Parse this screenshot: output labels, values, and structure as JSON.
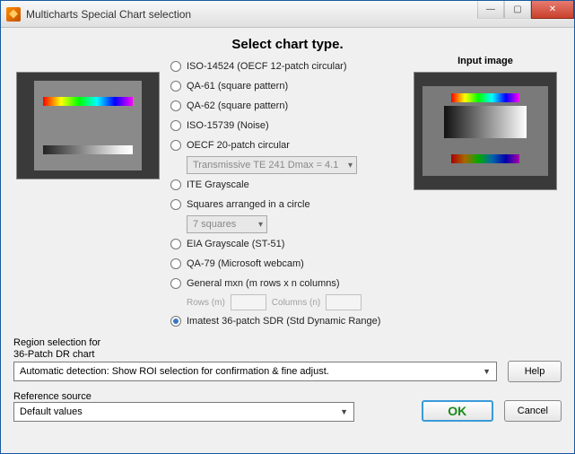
{
  "window": {
    "title": "Multicharts Special Chart selection"
  },
  "heading": "Select chart type.",
  "input_image_label": "Input image",
  "options": {
    "iso14524": "ISO-14524 (OECF 12-patch circular)",
    "qa61": "QA-61 (square pattern)",
    "qa62": "QA-62 (square pattern)",
    "iso15739": "ISO-15739 (Noise)",
    "oecf20": "OECF 20-patch circular",
    "oecf20_select": "Transmissive TE 241 Dmax = 4.1",
    "ite": "ITE Grayscale",
    "squares": "Squares arranged in a circle",
    "squares_select": "7  squares",
    "eia": "EIA Grayscale (ST-51)",
    "qa79": "QA-79 (Microsoft webcam)",
    "general": "General mxn (m rows x n columns)",
    "rows_label": "Rows (m)",
    "cols_label": "Columns (n)",
    "imatest36": "Imatest 36-patch SDR (Std Dynamic Range)"
  },
  "selected_option": "imatest36",
  "region_selection_label": "Region selection for\n36-Patch DR chart",
  "region_selection_value": "Automatic detection:  Show ROI selection for confirmation & fine adjust.",
  "reference_source_label": "Reference source",
  "reference_source_value": "Default values",
  "buttons": {
    "help": "Help",
    "ok": "OK",
    "cancel": "Cancel"
  }
}
